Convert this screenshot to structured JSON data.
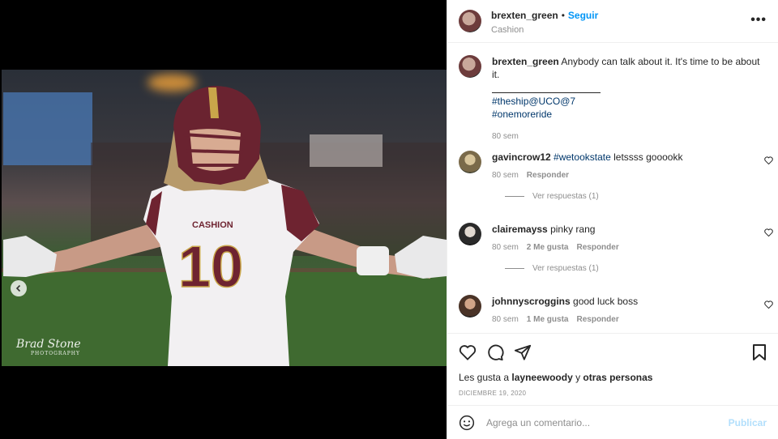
{
  "post": {
    "username": "brexten_green",
    "follow_label": "Seguir",
    "location": "Cashion",
    "more_label": "•••"
  },
  "media": {
    "watermark": "Brad Stone",
    "watermark_sub": "PHOTOGRAPHY",
    "jersey_text": "CASHION",
    "jersey_number": "10"
  },
  "caption": {
    "username": "brexten_green",
    "text": "Anybody can talk about it. It's time to be about it.",
    "tag1": "#theship@UCO@7",
    "tag2": "#onemoreride",
    "time": "80 sem"
  },
  "comments": [
    {
      "username": "gavincrow12",
      "hashtag": "#wetookstate",
      "text": " letssss gooookk",
      "time": "80 sem",
      "likes": "",
      "reply": "Responder",
      "replies": "Ver respuestas (1)"
    },
    {
      "username": "clairemayss",
      "text": " pinky rang",
      "time": "80 sem",
      "likes": "2 Me gusta",
      "reply": "Responder",
      "replies": "Ver respuestas (1)"
    },
    {
      "username": "johnnyscroggins",
      "text": " good luck boss",
      "time": "80 sem",
      "likes": "1 Me gusta",
      "reply": "Responder"
    }
  ],
  "likes": {
    "prefix": "Les gusta a ",
    "user": "layneewoody",
    "mid": " y ",
    "others": "otras personas"
  },
  "date": "DICIEMBRE 19, 2020",
  "composer": {
    "placeholder": "Agrega un comentario...",
    "publish": "Publicar"
  },
  "icons": [
    "emoji-icon",
    "heart-icon",
    "comment-icon",
    "share-icon",
    "bookmark-icon",
    "chevron-left-icon"
  ]
}
